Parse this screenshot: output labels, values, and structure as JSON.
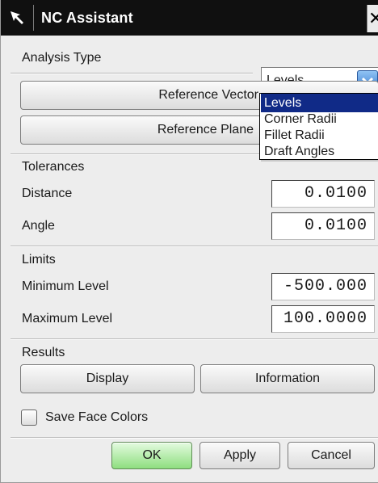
{
  "window": {
    "title": "NC Assistant",
    "close_glyph": "✕"
  },
  "analysis_type": {
    "label": "Analysis Type",
    "selected": "Levels",
    "options": [
      "Levels",
      "Corner Radii",
      "Fillet Radii",
      "Draft Angles"
    ]
  },
  "buttons": {
    "reference_vector": "Reference Vector",
    "reference_plane": "Reference Plane"
  },
  "tolerances": {
    "header": "Tolerances",
    "distance_label": "Distance",
    "distance_value": "0.0100",
    "angle_label": "Angle",
    "angle_value": "0.0100"
  },
  "limits": {
    "header": "Limits",
    "min_label": "Minimum Level",
    "min_value": "-500.000",
    "max_label": "Maximum Level",
    "max_value": "100.0000"
  },
  "results": {
    "header": "Results",
    "display": "Display",
    "information": "Information"
  },
  "save_face_colors": {
    "label": "Save Face Colors",
    "checked": false
  },
  "footer": {
    "ok": "OK",
    "apply": "Apply",
    "cancel": "Cancel"
  },
  "colors": {
    "titlebar": "#101010",
    "selection": "#102a87",
    "ok_button": "#8ede7f"
  }
}
